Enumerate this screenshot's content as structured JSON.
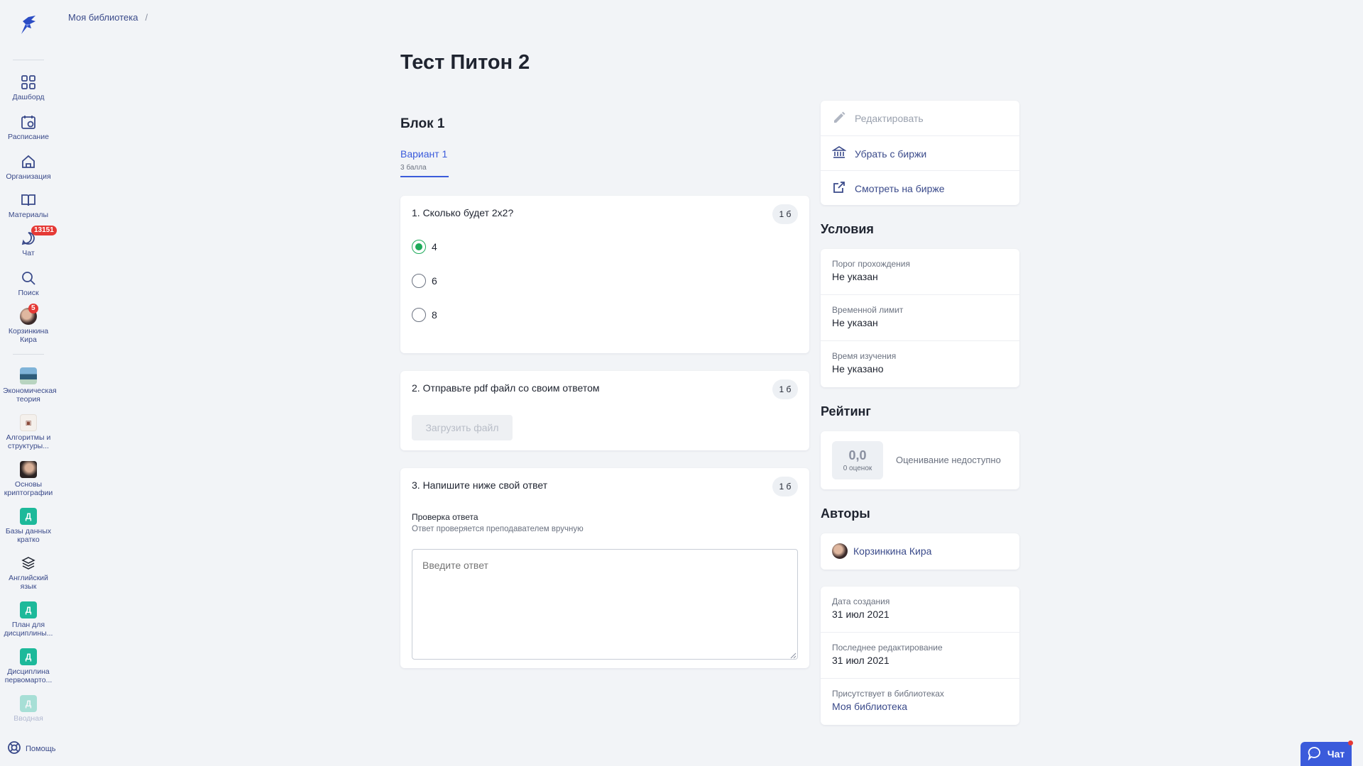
{
  "breadcrumb": {
    "library": "Моя библиотека",
    "separator": "/"
  },
  "sidebar": {
    "items": [
      {
        "label": "Дашборд",
        "icon": "grid-icon"
      },
      {
        "label": "Расписание",
        "icon": "calendar-icon"
      },
      {
        "label": "Организация",
        "icon": "home-icon"
      },
      {
        "label": "Материалы",
        "icon": "book-icon"
      },
      {
        "label": "Чат",
        "icon": "chat-icon",
        "badge": "13151"
      },
      {
        "label": "Поиск",
        "icon": "search-icon"
      },
      {
        "label": "Корзинкина Кира",
        "icon": "avatar",
        "badge": "5"
      }
    ],
    "courses": [
      {
        "label": "Экономическая теория"
      },
      {
        "label": "Алгоритмы и структуры..."
      },
      {
        "label": "Основы криптографии"
      },
      {
        "label": "Базы данных кратко",
        "letter": "Д"
      },
      {
        "label": "Английский язык"
      },
      {
        "label": "План для дисциплины...",
        "letter": "Д"
      },
      {
        "label": "Дисциплина первомарто...",
        "letter": "Д"
      },
      {
        "label": "Вводная",
        "letter": "Д"
      }
    ],
    "help": "Помощь"
  },
  "page": {
    "title": "Тест Питон 2"
  },
  "block": {
    "title": "Блок 1"
  },
  "variant": {
    "label": "Вариант 1",
    "points": "3 балла"
  },
  "questions": {
    "q1": {
      "text": "1. Сколько будет 2х2?",
      "points": "1 б",
      "options": [
        "4",
        "6",
        "8"
      ],
      "selected": "4"
    },
    "q2": {
      "text": "2. Отправьте pdf файл со своим ответом",
      "points": "1 б",
      "upload": "Загрузить файл"
    },
    "q3": {
      "text": "3. Напишите ниже свой ответ",
      "points": "1 б",
      "check_title": "Проверка ответа",
      "check_desc": "Ответ проверяется преподавателем вручную",
      "placeholder": "Введите ответ"
    }
  },
  "actions": {
    "edit": "Редактировать",
    "remove": "Убрать с биржи",
    "view": "Смотреть на бирже"
  },
  "conditions": {
    "title": "Условия",
    "rows": [
      {
        "key": "Порог прохождения",
        "value": "Не указан"
      },
      {
        "key": "Временной лимит",
        "value": "Не указан"
      },
      {
        "key": "Время изучения",
        "value": "Не указано"
      }
    ]
  },
  "rating": {
    "title": "Рейтинг",
    "value": "0,0",
    "count": "0 оценок",
    "note": "Оценивание недоступно"
  },
  "authors": {
    "title": "Авторы",
    "name": "Корзинкина Кира"
  },
  "meta": {
    "rows": [
      {
        "key": "Дата создания",
        "value": "31 июл 2021"
      },
      {
        "key": "Последнее редактирование",
        "value": "31 июл 2021"
      },
      {
        "key": "Присутствует в библиотеках",
        "value": "Моя библиотека"
      }
    ]
  },
  "chat_button": {
    "label": "Чат"
  },
  "colors": {
    "accent": "#3b5bdb",
    "success": "#1eaa5a",
    "badge": "#e53935",
    "course_letter": "#1db99a"
  }
}
